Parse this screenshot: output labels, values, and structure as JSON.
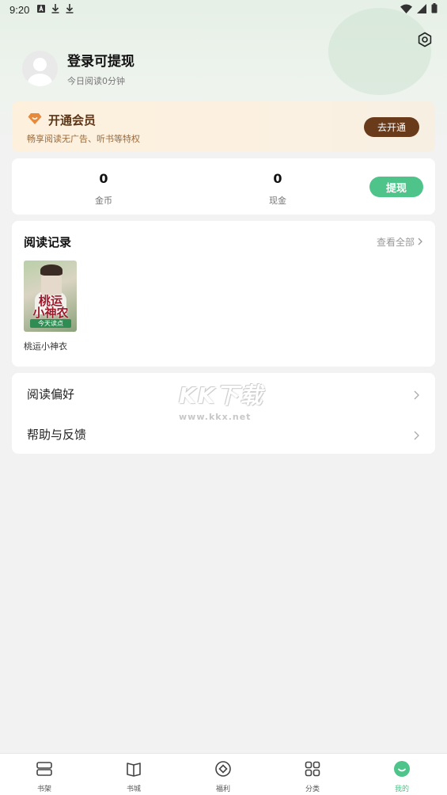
{
  "status_bar": {
    "time": "9:20",
    "left_icons": [
      "notification-a-icon",
      "download-icon",
      "download-icon"
    ],
    "right_icons": [
      "wifi-icon",
      "signal-icon",
      "battery-icon"
    ]
  },
  "profile": {
    "title": "登录可提现",
    "subtitle": "今日阅读0分钟"
  },
  "vip": {
    "title": "开通会员",
    "subtitle": "畅享阅读无广告、听书等特权",
    "button": "去开通"
  },
  "stats": {
    "coins_value": "0",
    "coins_label": "金币",
    "cash_value": "0",
    "cash_label": "现金",
    "withdraw_button": "提现"
  },
  "history": {
    "title": "阅读记录",
    "view_all": "查看全部",
    "books": [
      {
        "name": "桃运小神衣",
        "cover_title": "桃运\n小神农",
        "cover_subtitle": "今天读点"
      }
    ]
  },
  "menu": {
    "items": [
      {
        "label": "阅读偏好"
      },
      {
        "label": "帮助与反馈"
      }
    ]
  },
  "watermark": {
    "title": "KK下载",
    "url": "www.kkx.net"
  },
  "tabs": [
    {
      "label": "书架",
      "icon": "bookshelf-icon"
    },
    {
      "label": "书城",
      "icon": "book-store-icon"
    },
    {
      "label": "福利",
      "icon": "welfare-icon"
    },
    {
      "label": "分类",
      "icon": "category-icon"
    },
    {
      "label": "我的",
      "icon": "profile-icon"
    }
  ],
  "colors": {
    "accent_green": "#4fc48a",
    "vip_brown": "#6a3b1a",
    "background": "#f2f2f2"
  }
}
